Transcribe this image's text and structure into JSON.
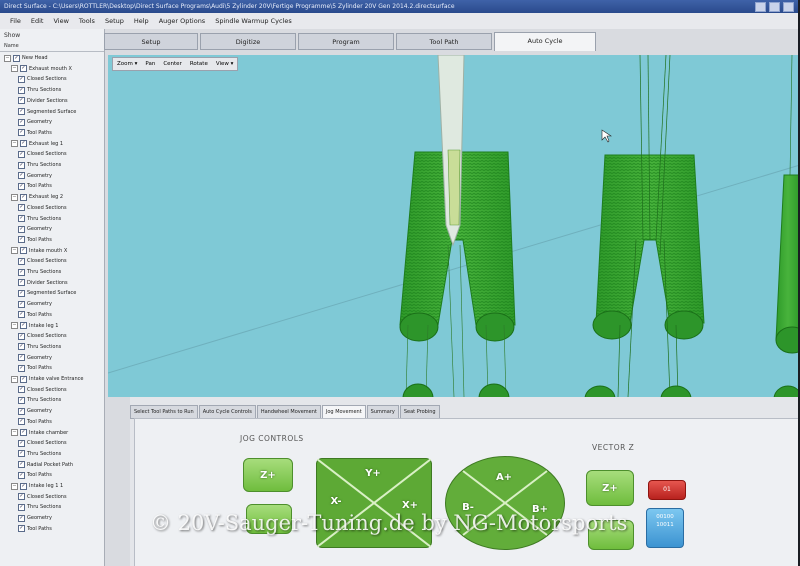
{
  "window": {
    "title": "Direct Surface - C:\\Users\\ROTTLER\\Desktop\\Direct Surface Programs\\Audi\\5 Zylinder 20V\\Fertige Programme\\5 Zylinder 20V Gen 2014.2.directsurface"
  },
  "menu": [
    "File",
    "Edit",
    "View",
    "Tools",
    "Setup",
    "Help",
    "Auger Options",
    "Spindle Warmup Cycles"
  ],
  "left_panel": {
    "show_label": "Show",
    "header": "Name",
    "tree": [
      {
        "label": "New Head",
        "indent": 0,
        "expander": "−"
      },
      {
        "label": "Exhaust mouth X",
        "indent": 1,
        "expander": "−"
      },
      {
        "label": "Closed Sections",
        "indent": 2
      },
      {
        "label": "Thru Sections",
        "indent": 2
      },
      {
        "label": "Divider Sections",
        "indent": 2
      },
      {
        "label": "Segmented Surface",
        "indent": 2
      },
      {
        "label": "Geometry",
        "indent": 2
      },
      {
        "label": "Tool Paths",
        "indent": 2
      },
      {
        "label": "Exhaust leg 1",
        "indent": 1,
        "expander": "−"
      },
      {
        "label": "Closed Sections",
        "indent": 2
      },
      {
        "label": "Thru Sections",
        "indent": 2
      },
      {
        "label": "Geometry",
        "indent": 2
      },
      {
        "label": "Tool Paths",
        "indent": 2
      },
      {
        "label": "Exhaust leg 2",
        "indent": 1,
        "expander": "−"
      },
      {
        "label": "Closed Sections",
        "indent": 2
      },
      {
        "label": "Thru Sections",
        "indent": 2
      },
      {
        "label": "Geometry",
        "indent": 2
      },
      {
        "label": "Tool Paths",
        "indent": 2
      },
      {
        "label": "Intake mouth X",
        "indent": 1,
        "expander": "−"
      },
      {
        "label": "Closed Sections",
        "indent": 2
      },
      {
        "label": "Thru Sections",
        "indent": 2
      },
      {
        "label": "Divider Sections",
        "indent": 2
      },
      {
        "label": "Segmented Surface",
        "indent": 2
      },
      {
        "label": "Geometry",
        "indent": 2
      },
      {
        "label": "Tool Paths",
        "indent": 2
      },
      {
        "label": "Intake leg 1",
        "indent": 1,
        "expander": "−"
      },
      {
        "label": "Closed Sections",
        "indent": 2
      },
      {
        "label": "Thru Sections",
        "indent": 2
      },
      {
        "label": "Geometry",
        "indent": 2
      },
      {
        "label": "Tool Paths",
        "indent": 2
      },
      {
        "label": "Intake valve Entrance",
        "indent": 1,
        "expander": "−"
      },
      {
        "label": "Closed Sections",
        "indent": 2
      },
      {
        "label": "Thru Sections",
        "indent": 2
      },
      {
        "label": "Geometry",
        "indent": 2
      },
      {
        "label": "Tool Paths",
        "indent": 2
      },
      {
        "label": "Intake chamber",
        "indent": 1,
        "expander": "−"
      },
      {
        "label": "Closed Sections",
        "indent": 2
      },
      {
        "label": "Thru Sections",
        "indent": 2
      },
      {
        "label": "Radial Pocket Path",
        "indent": 2
      },
      {
        "label": "Tool Paths",
        "indent": 2
      },
      {
        "label": "Intake leg 1 1",
        "indent": 1,
        "expander": "−"
      },
      {
        "label": "Closed Sections",
        "indent": 2
      },
      {
        "label": "Thru Sections",
        "indent": 2
      },
      {
        "label": "Geometry",
        "indent": 2
      },
      {
        "label": "Tool Paths",
        "indent": 2
      }
    ]
  },
  "tabs": [
    "Setup",
    "Digitize",
    "Program",
    "Tool Path",
    "Auto Cycle"
  ],
  "active_tab": "Auto Cycle",
  "viewport_toolbar": [
    "Zoom ▾",
    "Pan",
    "Center",
    "Rotate",
    "View ▾"
  ],
  "bottom_tabs": [
    "Select Tool Paths to Run",
    "Auto Cycle Controls",
    "Handwheel Movement",
    "Jog Movement",
    "Summary",
    "Seat Probing"
  ],
  "active_bottom_tab": "Jog Movement",
  "jog": {
    "title": "JOG CONTROLS",
    "z_plus": "Z+",
    "y_plus": "Y+",
    "x_minus": "X-",
    "x_plus": "X+",
    "a_plus": "A+",
    "b_minus": "B-",
    "b_plus": "B+"
  },
  "vector": {
    "title": "VECTOR Z",
    "z_plus": "Z+",
    "red_label": "01",
    "blue_label_1": "00100",
    "blue_label_2": "10011"
  },
  "watermark": "© 20V-Sauger-Tuning.de by NG-Motorsports",
  "colors": {
    "viewport_bg": "#7fc9d6",
    "toolpath_green": "#1f8a1f",
    "jog_green": "#7cc44a"
  }
}
